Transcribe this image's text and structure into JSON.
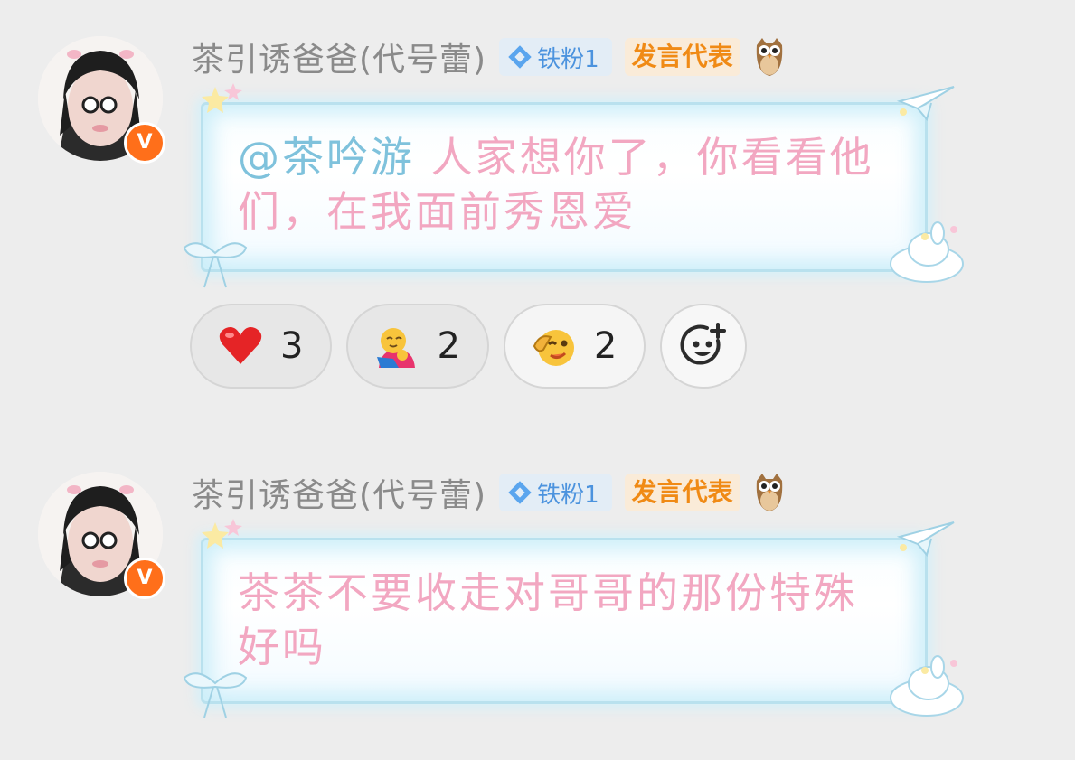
{
  "messages": [
    {
      "username": "茶引诱爸爸(代号蕾)",
      "fan_badge": "铁粉1",
      "role_badge": "发言代表",
      "mention": "@茶吟游",
      "text": " 人家想你了，你看看他们，在我面前秀恩爱",
      "reactions": [
        {
          "emoji": "heart-emoji",
          "count": "3"
        },
        {
          "emoji": "hug-emoji",
          "count": "2"
        },
        {
          "emoji": "salute-wink-emoji",
          "count": "2"
        }
      ]
    },
    {
      "username": "茶引诱爸爸(代号蕾)",
      "fan_badge": "铁粉1",
      "role_badge": "发言代表",
      "text": "茶茶不要收走对哥哥的那份特殊好吗"
    }
  ],
  "colors": {
    "background": "#ededed",
    "username": "#8a8a8a",
    "message_text": "#f2a7c1",
    "mention": "#7fc2dc",
    "fan_badge_text": "#4c93de",
    "role_badge_text": "#f08a15",
    "verified": "#ff6f1a"
  }
}
